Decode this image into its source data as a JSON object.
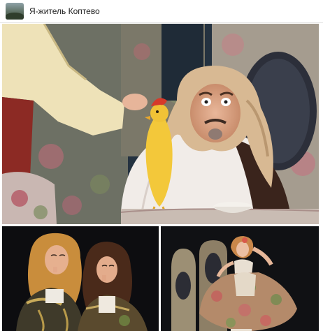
{
  "header": {
    "community_name": "Я-житель Коптево"
  },
  "icons": {
    "avatar": "community-avatar"
  },
  "colors": {
    "header_bg": "#ffffff",
    "title_text": "#222222",
    "stage_dark": "#111111"
  }
}
